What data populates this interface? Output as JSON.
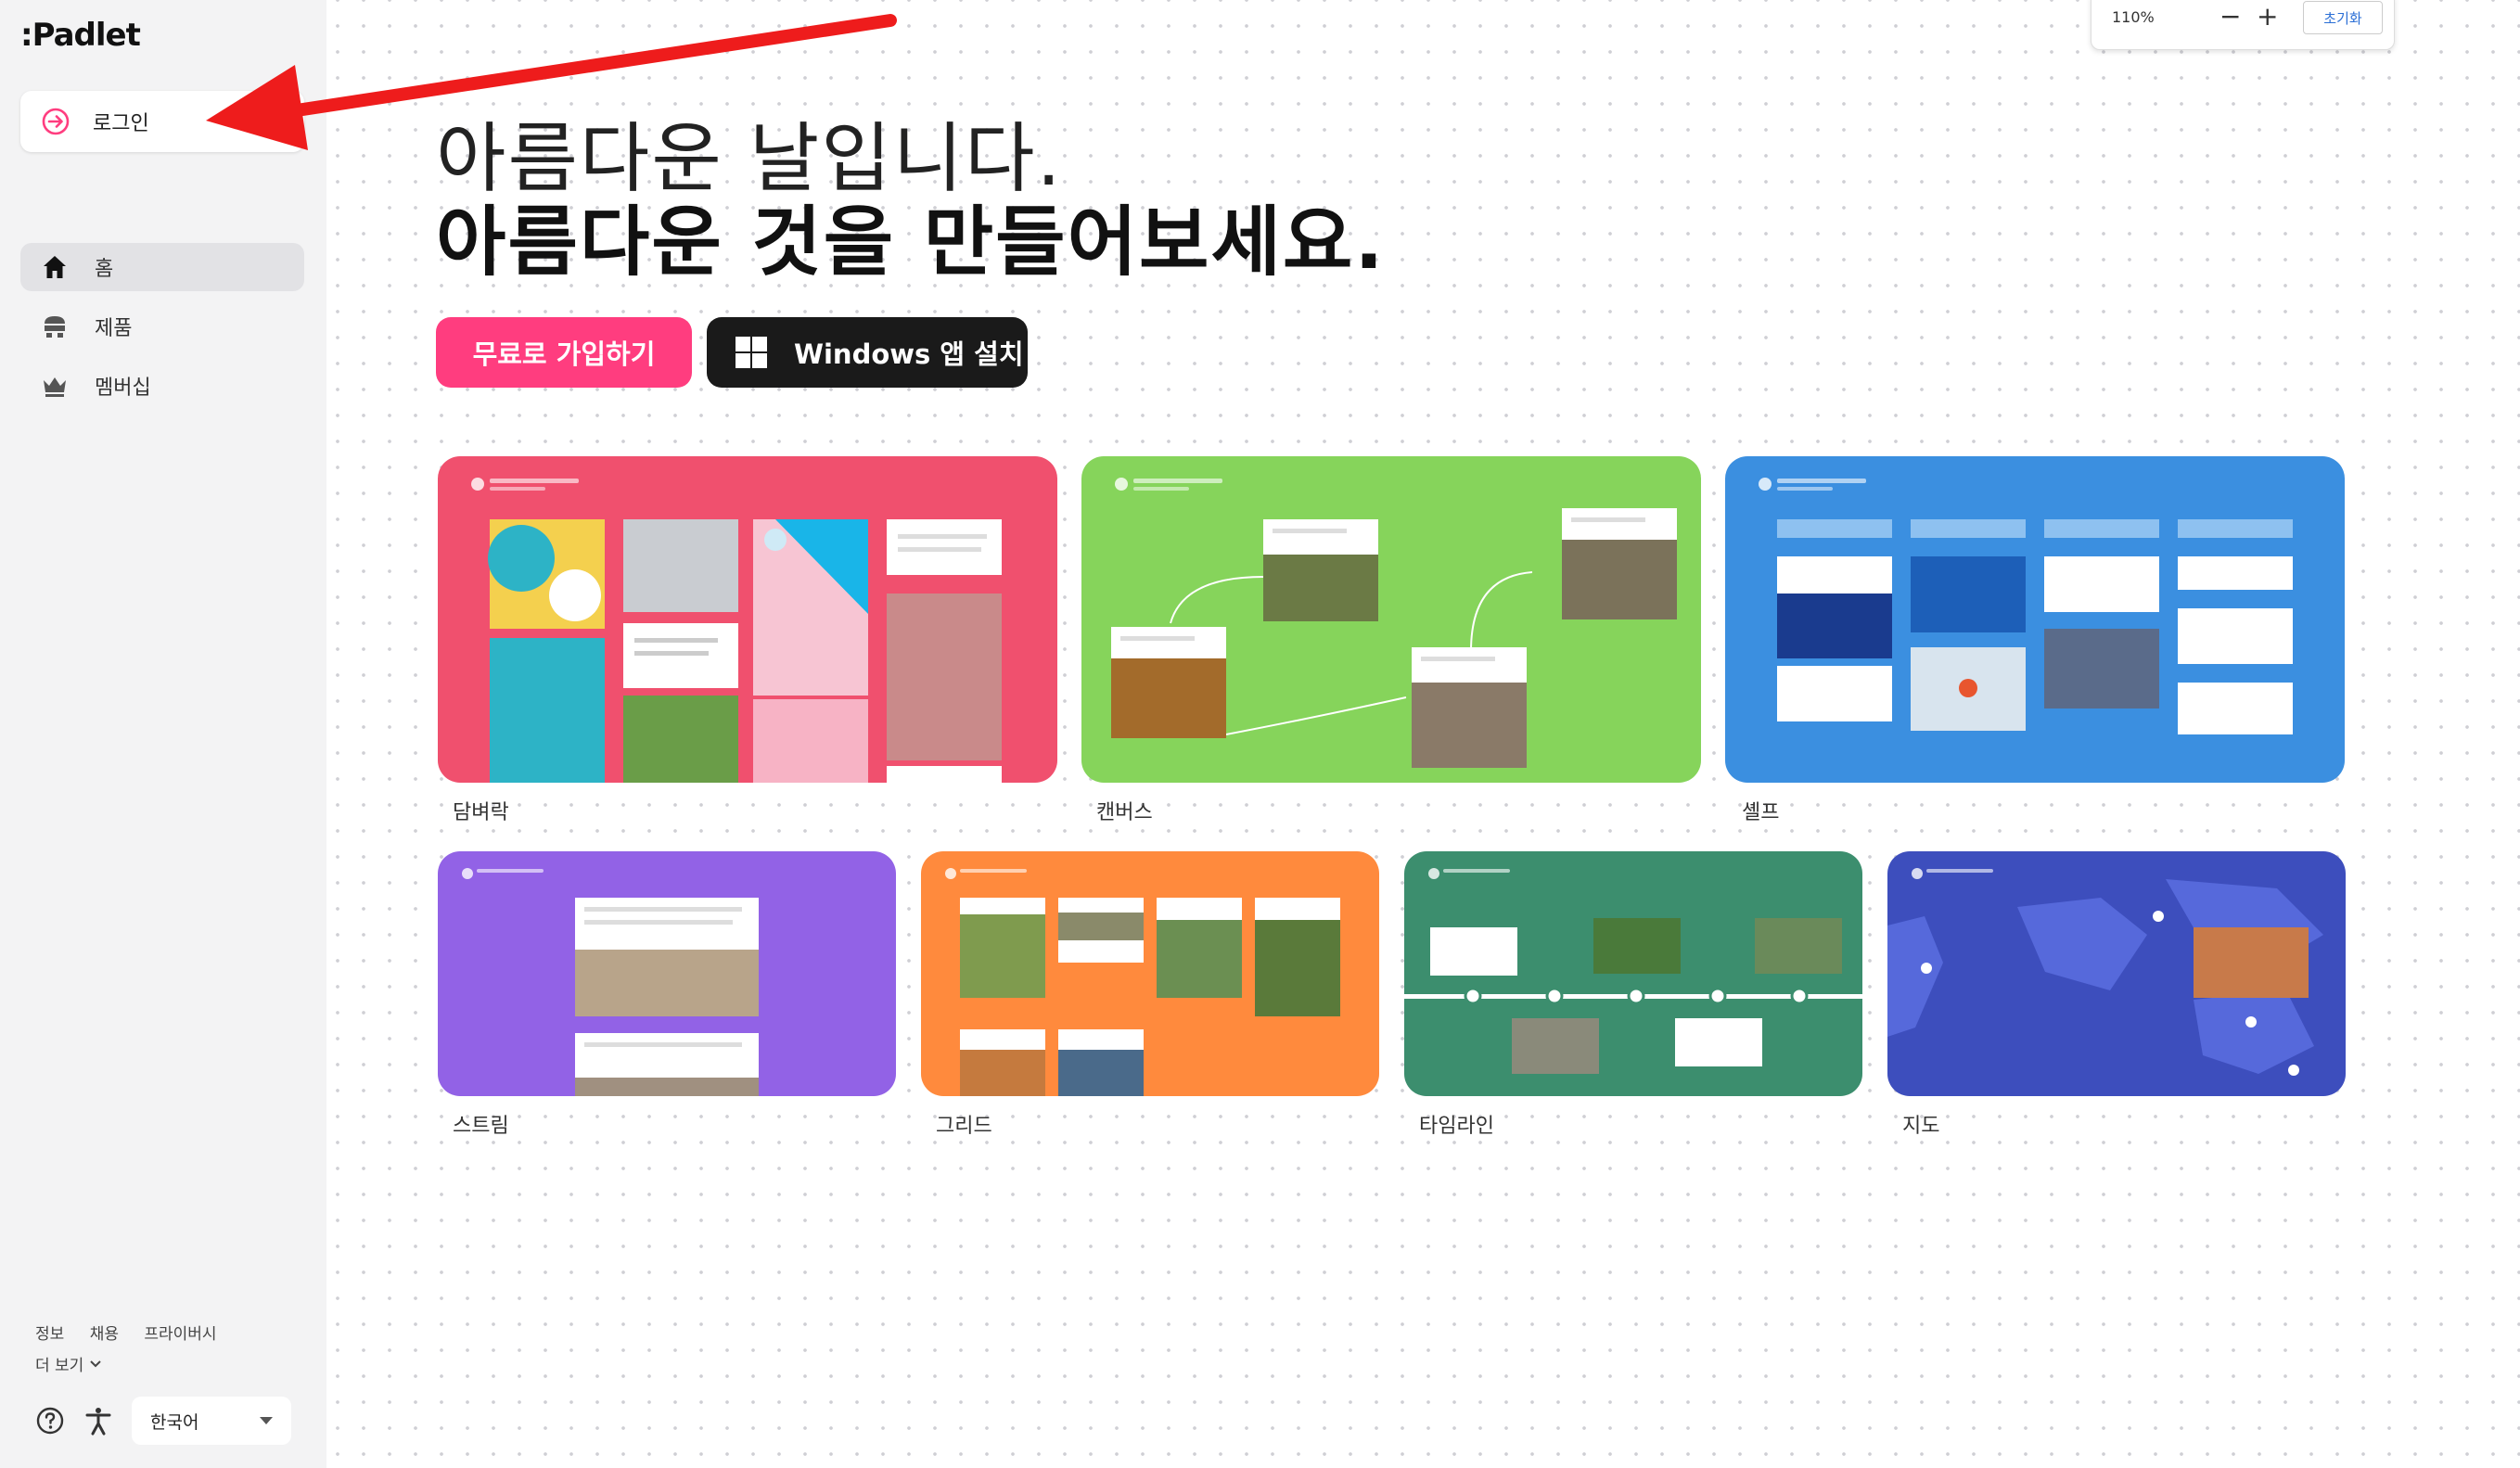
{
  "app": {
    "logo": ":Padlet"
  },
  "sidebar": {
    "login_label": "로그인",
    "nav": [
      {
        "label": "홈",
        "icon": "home-icon"
      },
      {
        "label": "제품",
        "icon": "products-icon"
      },
      {
        "label": "멤버십",
        "icon": "crown-icon"
      }
    ],
    "footer_links": [
      "정보",
      "채용",
      "프라이버시"
    ],
    "more_label": "더 보기",
    "language": "한국어"
  },
  "zoom": {
    "level": "110%",
    "reset_label": "초기화"
  },
  "hero": {
    "line1": "아름다운 날입니다.",
    "line2": "아름다운 것을 만들어보세요.",
    "signup_label": "무료로 가입하기",
    "windows_label": "Windows 앱 설치"
  },
  "formats": [
    {
      "label": "담벼락",
      "color": "#f0506e"
    },
    {
      "label": "캔버스",
      "color": "#86d45b"
    },
    {
      "label": "셸프",
      "color": "#3b8fe0"
    },
    {
      "label": "스트림",
      "color": "#9262e6"
    },
    {
      "label": "그리드",
      "color": "#ff8a3d"
    },
    {
      "label": "타임라인",
      "color": "#3c8e6e"
    },
    {
      "label": "지도",
      "color": "#3d4ebd"
    }
  ],
  "colors": {
    "accent": "#ff3d7f",
    "annotation_arrow": "#ee1c1c"
  }
}
